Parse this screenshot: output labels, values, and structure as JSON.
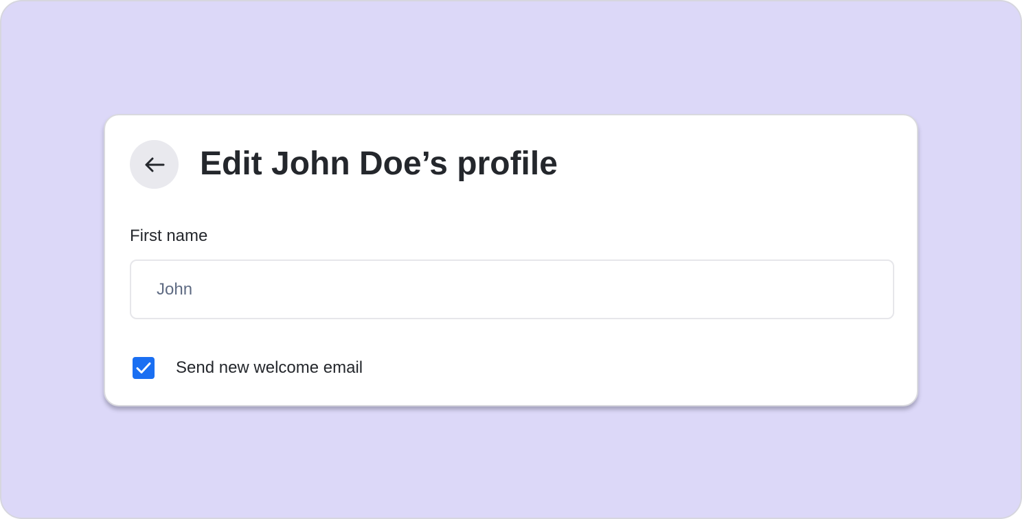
{
  "header": {
    "back_icon": "arrow-left-icon",
    "title": "Edit John Doe’s profile"
  },
  "form": {
    "first_name": {
      "label": "First name",
      "value": "John"
    },
    "welcome_email": {
      "label": "Send new welcome email",
      "checked": true,
      "icon": "checkmark-icon"
    }
  },
  "colors": {
    "background": "#dcd8f8",
    "card": "#ffffff",
    "accent": "#1a6ff2",
    "text": "#24272c",
    "input_text": "#5f6b83",
    "back_button_bg": "#e9e9ee"
  }
}
